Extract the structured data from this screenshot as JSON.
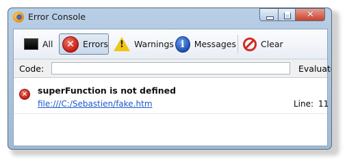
{
  "window": {
    "title": "Error Console"
  },
  "toolbar": {
    "all": {
      "label": "All",
      "icon": "all-messages-icon"
    },
    "errors": {
      "label": "Errors",
      "icon": "error-icon",
      "selected": true
    },
    "warnings": {
      "label": "Warnings",
      "icon": "warning-icon"
    },
    "messages": {
      "label": "Messages",
      "icon": "info-icon"
    },
    "clear": {
      "label": "Clear",
      "icon": "clear-icon"
    }
  },
  "code": {
    "label": "Code:",
    "value": "",
    "evaluate_label": "Evaluate"
  },
  "entries": [
    {
      "type": "error",
      "message": "superFunction is not defined",
      "source": "file:///C:/Sebastien/fake.htm",
      "line_label": "Line:",
      "line": "11"
    }
  ],
  "colors": {
    "error": "#c41c10",
    "link": "#1a58c7",
    "title_bar": "#b8cfe6"
  }
}
